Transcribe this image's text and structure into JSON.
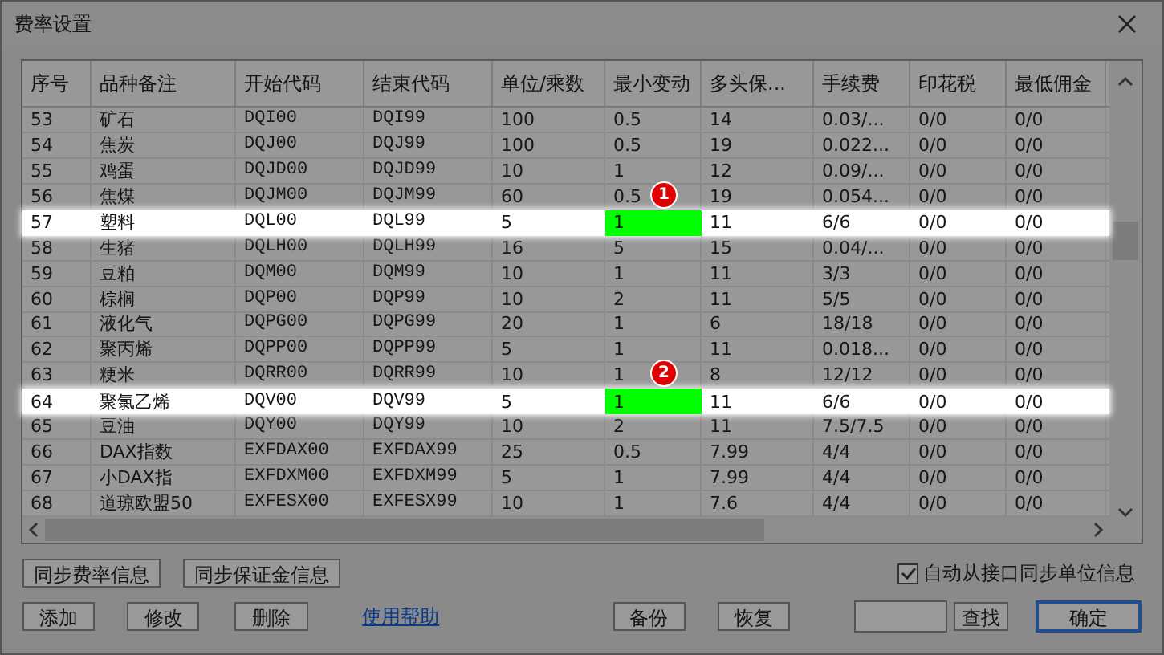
{
  "window": {
    "title": "费率设置"
  },
  "table": {
    "columns": [
      "序号",
      "品种备注",
      "开始代码",
      "结束代码",
      "单位/乘数",
      "最小变动",
      "多头保...",
      "手续费",
      "印花税",
      "最低佣金"
    ],
    "rows": [
      {
        "cells": [
          "53",
          "矿石",
          "DQI00",
          "DQI99",
          "100",
          "0.5",
          "14",
          "0.03/...",
          "0/0",
          "0/0"
        ],
        "highlighted": false,
        "flagged": false
      },
      {
        "cells": [
          "54",
          "焦炭",
          "DQJ00",
          "DQJ99",
          "100",
          "0.5",
          "19",
          "0.022...",
          "0/0",
          "0/0"
        ],
        "highlighted": false,
        "flagged": false
      },
      {
        "cells": [
          "55",
          "鸡蛋",
          "DQJD00",
          "DQJD99",
          "10",
          "1",
          "12",
          "0.09/...",
          "0/0",
          "0/0"
        ],
        "highlighted": false,
        "flagged": false
      },
      {
        "cells": [
          "56",
          "焦煤",
          "DQJM00",
          "DQJM99",
          "60",
          "0.5",
          "19",
          "0.054...",
          "0/0",
          "0/0"
        ],
        "highlighted": false,
        "flagged": false,
        "badge": "1"
      },
      {
        "cells": [
          "57",
          "塑料",
          "DQL00",
          "DQL99",
          "5",
          "1",
          "11",
          "6/6",
          "0/0",
          "0/0"
        ],
        "highlighted": true,
        "flagged": true
      },
      {
        "cells": [
          "58",
          "生猪",
          "DQLH00",
          "DQLH99",
          "16",
          "5",
          "15",
          "0.04/...",
          "0/0",
          "0/0"
        ],
        "highlighted": false,
        "flagged": false
      },
      {
        "cells": [
          "59",
          "豆粕",
          "DQM00",
          "DQM99",
          "10",
          "1",
          "11",
          "3/3",
          "0/0",
          "0/0"
        ],
        "highlighted": false,
        "flagged": false
      },
      {
        "cells": [
          "60",
          "棕榈",
          "DQP00",
          "DQP99",
          "10",
          "2",
          "11",
          "5/5",
          "0/0",
          "0/0"
        ],
        "highlighted": false,
        "flagged": false
      },
      {
        "cells": [
          "61",
          "液化气",
          "DQPG00",
          "DQPG99",
          "20",
          "1",
          "6",
          "18/18",
          "0/0",
          "0/0"
        ],
        "highlighted": false,
        "flagged": false
      },
      {
        "cells": [
          "62",
          "聚丙烯",
          "DQPP00",
          "DQPP99",
          "5",
          "1",
          "11",
          "0.018...",
          "0/0",
          "0/0"
        ],
        "highlighted": false,
        "flagged": false
      },
      {
        "cells": [
          "63",
          "粳米",
          "DQRR00",
          "DQRR99",
          "10",
          "1",
          "8",
          "12/12",
          "0/0",
          "0/0"
        ],
        "highlighted": false,
        "flagged": false,
        "badge": "2"
      },
      {
        "cells": [
          "64",
          "聚氯乙烯",
          "DQV00",
          "DQV99",
          "5",
          "1",
          "11",
          "6/6",
          "0/0",
          "0/0"
        ],
        "highlighted": true,
        "flagged": true
      },
      {
        "cells": [
          "65",
          "豆油",
          "DQY00",
          "DQY99",
          "10",
          "2",
          "11",
          "7.5/7.5",
          "0/0",
          "0/0"
        ],
        "highlighted": false,
        "flagged": false
      },
      {
        "cells": [
          "66",
          "DAX指数",
          "EXFDAX00",
          "EXFDAX99",
          "25",
          "0.5",
          "7.99",
          "4/4",
          "0/0",
          "0/0"
        ],
        "highlighted": false,
        "flagged": false
      },
      {
        "cells": [
          "67",
          "小DAX指",
          "EXFDXM00",
          "EXFDXM99",
          "5",
          "1",
          "7.99",
          "4/4",
          "0/0",
          "0/0"
        ],
        "highlighted": false,
        "flagged": false
      },
      {
        "cells": [
          "68",
          "道琼欧盟50",
          "EXFESX00",
          "EXFESX99",
          "10",
          "1",
          "7.6",
          "4/4",
          "0/0",
          "0/0"
        ],
        "highlighted": false,
        "flagged": false
      }
    ]
  },
  "sync_buttons": [
    "同步费率信息",
    "同步保证金信息"
  ],
  "auto_sync": {
    "label": "自动从接口同步单位信息",
    "checked": true
  },
  "actions": [
    {
      "kind": "button",
      "label": "添加"
    },
    {
      "kind": "button",
      "label": "修改"
    },
    {
      "kind": "button",
      "label": "删除"
    },
    {
      "kind": "link",
      "label": "使用帮助"
    },
    {
      "kind": "button",
      "label": "备份"
    },
    {
      "kind": "button",
      "label": "恢复"
    },
    {
      "kind": "search",
      "label": "查找"
    },
    {
      "kind": "primary",
      "label": "确定"
    }
  ]
}
